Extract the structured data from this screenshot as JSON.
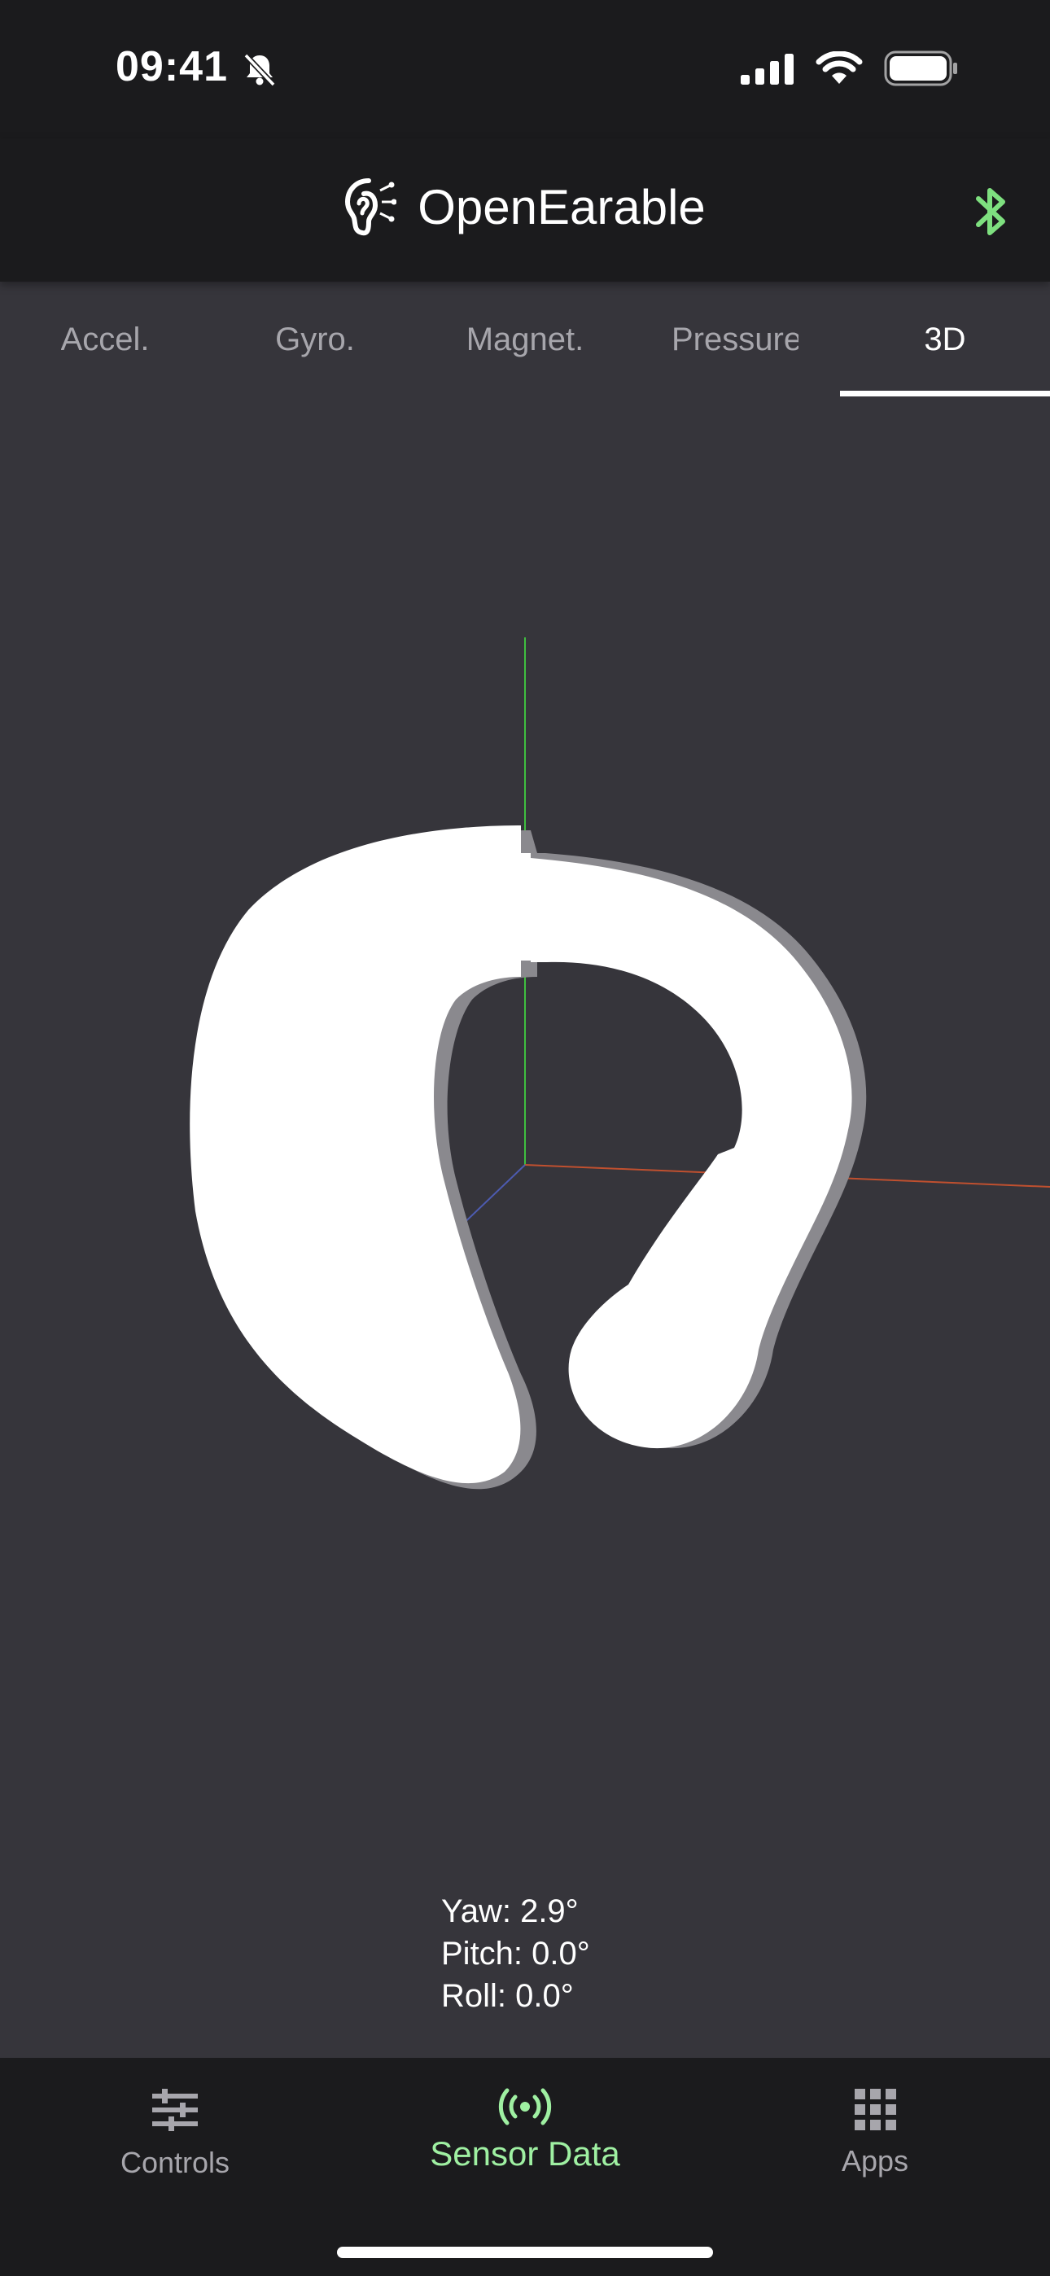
{
  "status": {
    "time": "09:41"
  },
  "app": {
    "title": "OpenEarable"
  },
  "tabs": [
    {
      "label": "Accel."
    },
    {
      "label": "Gyro."
    },
    {
      "label": "Magnet."
    },
    {
      "label": "Pressure"
    },
    {
      "label": "3D"
    }
  ],
  "active_tab": "3D",
  "orientation": {
    "yaw": "Yaw: 2.9°",
    "pitch": "Pitch: 0.0°",
    "roll": "Roll: 0.0°"
  },
  "bottom_nav": {
    "items": [
      {
        "label": "Controls",
        "icon": "sliders-icon"
      },
      {
        "label": "Sensor Data",
        "icon": "broadcast-icon"
      },
      {
        "label": "Apps",
        "icon": "grid-icon"
      }
    ],
    "active": "Sensor Data"
  },
  "colors": {
    "accent": "#9ff0a2",
    "bluetooth": "#7ee07f",
    "background": "#36353b",
    "bars": "#1b1b1d"
  }
}
